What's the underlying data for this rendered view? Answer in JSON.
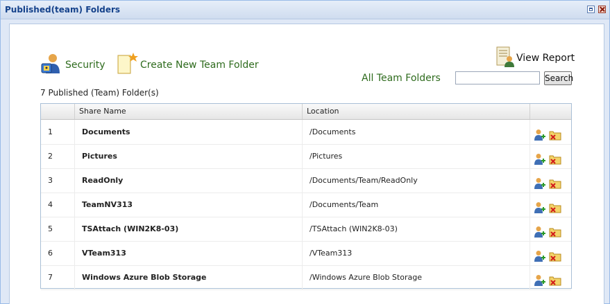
{
  "window": {
    "title": "Published(team) Folders"
  },
  "toolbar": {
    "security_label": "Security",
    "create_label": "Create New Team Folder",
    "view_report_label": "View Report",
    "all_folders_label": "All Team Folders"
  },
  "search": {
    "value": "",
    "placeholder": "",
    "button_label": "Search"
  },
  "summary": {
    "count_text": "7 Published (Team) Folder(s)"
  },
  "grid": {
    "columns": [
      "",
      "Share Name",
      "Location",
      ""
    ],
    "rows": [
      {
        "num": "1",
        "name": "Documents",
        "location": "/Documents"
      },
      {
        "num": "2",
        "name": "Pictures",
        "location": "/Pictures"
      },
      {
        "num": "3",
        "name": "ReadOnly",
        "location": "/Documents/Team/ReadOnly"
      },
      {
        "num": "4",
        "name": "TeamNV313",
        "location": "/Documents/Team"
      },
      {
        "num": "5",
        "name": "TSAttach (WIN2K8-03)",
        "location": "/TSAttach (WIN2K8-03)"
      },
      {
        "num": "6",
        "name": "VTeam313",
        "location": "/VTeam313"
      },
      {
        "num": "7",
        "name": "Windows Azure Blob Storage",
        "location": "/Windows Azure Blob Storage"
      }
    ],
    "row_icons": {
      "add": "add-user-icon",
      "delete": "delete-folder-icon"
    }
  },
  "colors": {
    "title": "#15428b",
    "link": "#2e6b1d",
    "border": "#99bbe8"
  }
}
